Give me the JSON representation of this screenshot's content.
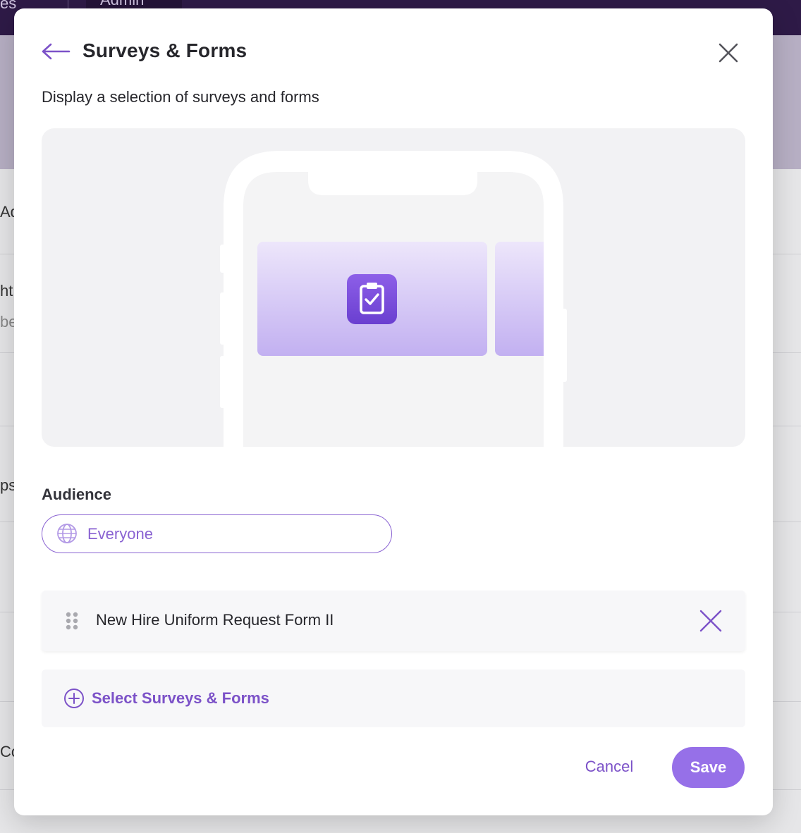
{
  "background": {
    "nav_fragment": "es",
    "admin_menu": "Admin",
    "fragments": [
      "Ad",
      "ht",
      "be",
      "ps",
      "Co"
    ]
  },
  "modal": {
    "title": "Surveys & Forms",
    "subtitle": "Display a selection of surveys and forms",
    "preview_icon": "clipboard-check-icon",
    "audience": {
      "label": "Audience",
      "value": "Everyone",
      "icon": "globe-icon"
    },
    "items": [
      {
        "name": "New Hire Uniform Request Form II"
      }
    ],
    "select_label": "Select Surveys & Forms",
    "cancel_label": "Cancel",
    "save_label": "Save"
  },
  "colors": {
    "accent": "#7c52c8",
    "save_button": "#9670e8",
    "overlay_nav": "#2e1a47"
  }
}
